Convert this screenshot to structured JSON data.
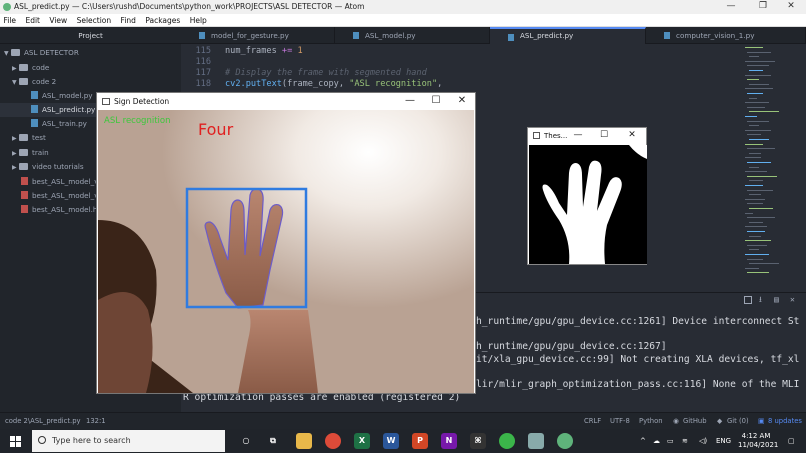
{
  "titlebar": {
    "title": "ASL_predict.py — C:\\Users\\rushd\\Documents\\python_work\\PROJECTS\\ASL DETECTOR — Atom",
    "minimize": "—",
    "maximize": "❐",
    "close": "✕"
  },
  "menubar": [
    "File",
    "Edit",
    "View",
    "Selection",
    "Find",
    "Packages",
    "Help"
  ],
  "project_panel": {
    "header": "Project",
    "root": "ASL DETECTOR",
    "items": [
      "code",
      "code 2",
      "ASL_model.py",
      "ASL_predict.py",
      "ASL_train.py",
      "test",
      "train",
      "video tutorials",
      "best_ASL_model_v2",
      "best_ASL_model_v3",
      "best_ASL_model.h5"
    ]
  },
  "tabs": [
    "model_for_gesture.py",
    "ASL_model.py",
    "ASL_predict.py",
    "computer_vision_1.py"
  ],
  "editor": {
    "line_numbers": [
      "115",
      "116",
      "117",
      "118"
    ],
    "line115": {
      "var": "num_frames",
      "op": " += ",
      "num": "1"
    },
    "line117": "# Display the frame with segmented hand",
    "line118": {
      "fn": "cv2.putText",
      "args": "(frame_copy, ",
      "str": "\"ASL recognition\"",
      "tail": ","
    }
  },
  "terminal": {
    "lines": [
      "h_runtime/gpu/gpu_device.cc:1261] Device interconnect St",
      "h_runtime/gpu/gpu_device.cc:1267]",
      "it/xla_gpu_device.cc:99] Not creating XLA devices, tf_xl",
      "lir/mlir_graph_optimization_pass.cc:116] None of the MLI",
      "R optimization passes are enabled (registered 2)"
    ]
  },
  "statusbar": {
    "path": "code 2\\ASL_predict.py",
    "cursor": "132:1",
    "line_ending": "CRLF",
    "encoding": "UTF-8",
    "grammar": "Python",
    "github": "GitHub",
    "git": "Git (0)",
    "updates": "8 updates"
  },
  "sign_window": {
    "title": "Sign Detection",
    "overlay_label": "ASL recognition",
    "prediction": "Four"
  },
  "thresh_window": {
    "title": "Thes..."
  },
  "taskbar": {
    "search_placeholder": "Type here to search",
    "language": "ENG",
    "time": "4:12 AM",
    "date": "11/04/2021"
  },
  "colors": {
    "editor_bg": "#282c34",
    "panel_bg": "#21252b",
    "accent": "#568af2",
    "prediction_text": "#e02020",
    "overlay_text": "#3cc83c",
    "roi_box": "#2f7be0"
  }
}
